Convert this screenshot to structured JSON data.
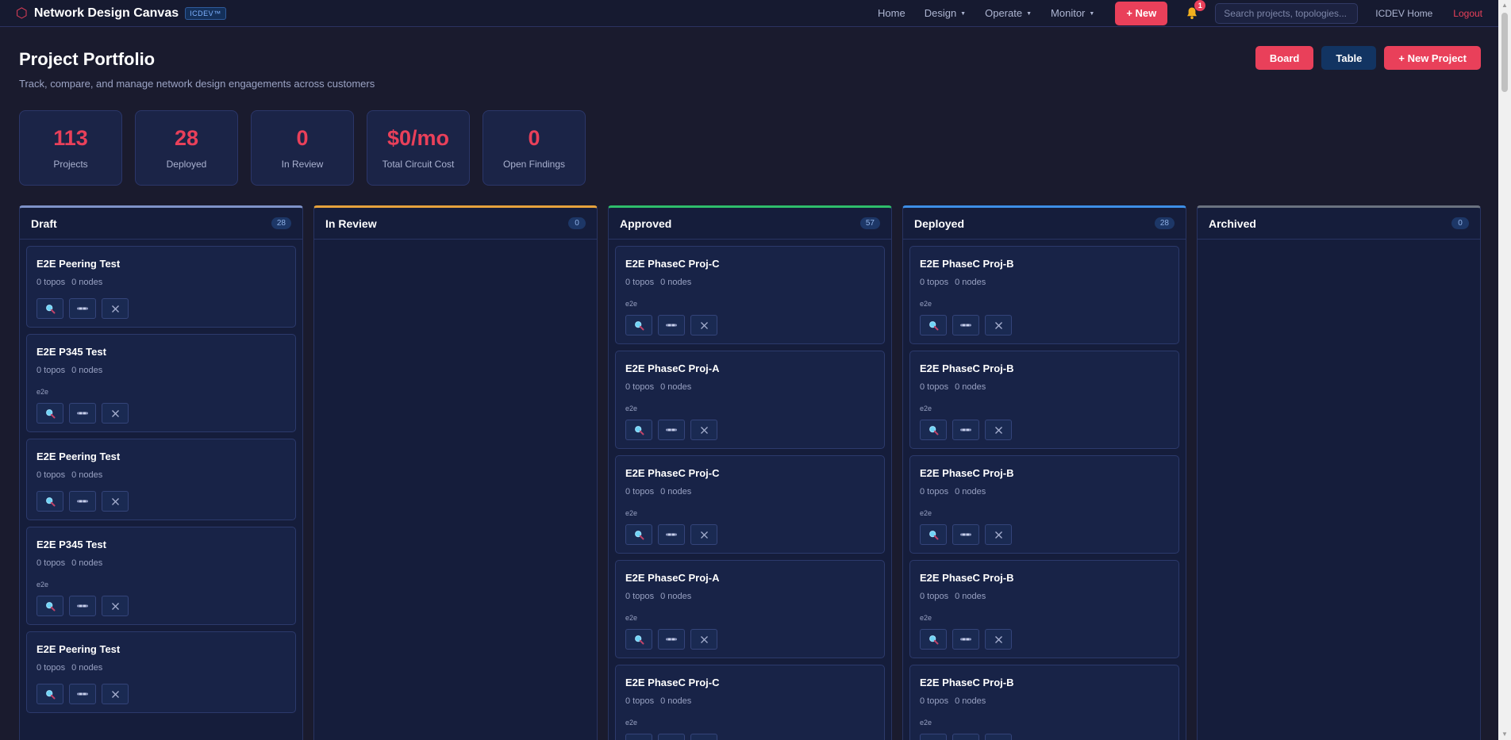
{
  "nav": {
    "brand": "Network Design Canvas",
    "badge": "ICDEV™",
    "links": [
      "Home",
      "Design",
      "Operate",
      "Monitor"
    ],
    "new_label": "+ New",
    "notification_count": "1",
    "search_placeholder": "Search projects, topologies...",
    "icdev_home": "ICDEV Home",
    "logout": "Logout"
  },
  "header": {
    "title": "Project Portfolio",
    "subtitle": "Track, compare, and manage network design engagements across customers",
    "board_label": "Board",
    "table_label": "Table",
    "new_project_label": "+ New Project"
  },
  "stats": [
    {
      "value": "113",
      "label": "Projects"
    },
    {
      "value": "28",
      "label": "Deployed"
    },
    {
      "value": "0",
      "label": "In Review"
    },
    {
      "value": "$0/mo",
      "label": "Total Circuit Cost"
    },
    {
      "value": "0",
      "label": "Open Findings"
    }
  ],
  "columns": [
    {
      "title": "Draft",
      "count": "28",
      "accent": "#7e92c8",
      "cards": [
        {
          "title": "E2E Peering Test",
          "topos": "0 topos",
          "nodes": "0 nodes",
          "tag": ""
        },
        {
          "title": "E2E P345 Test",
          "topos": "0 topos",
          "nodes": "0 nodes",
          "tag": "e2e"
        },
        {
          "title": "E2E Peering Test",
          "topos": "0 topos",
          "nodes": "0 nodes",
          "tag": ""
        },
        {
          "title": "E2E P345 Test",
          "topos": "0 topos",
          "nodes": "0 nodes",
          "tag": "e2e"
        },
        {
          "title": "E2E Peering Test",
          "topos": "0 topos",
          "nodes": "0 nodes",
          "tag": ""
        }
      ]
    },
    {
      "title": "In Review",
      "count": "0",
      "accent": "#e6a23c",
      "cards": []
    },
    {
      "title": "Approved",
      "count": "57",
      "accent": "#2ebd6b",
      "cards": [
        {
          "title": "E2E PhaseC Proj-C",
          "topos": "0 topos",
          "nodes": "0 nodes",
          "tag": "e2e"
        },
        {
          "title": "E2E PhaseC Proj-A",
          "topos": "0 topos",
          "nodes": "0 nodes",
          "tag": "e2e"
        },
        {
          "title": "E2E PhaseC Proj-C",
          "topos": "0 topos",
          "nodes": "0 nodes",
          "tag": "e2e"
        },
        {
          "title": "E2E PhaseC Proj-A",
          "topos": "0 topos",
          "nodes": "0 nodes",
          "tag": "e2e"
        },
        {
          "title": "E2E PhaseC Proj-C",
          "topos": "0 topos",
          "nodes": "0 nodes",
          "tag": "e2e"
        }
      ]
    },
    {
      "title": "Deployed",
      "count": "28",
      "accent": "#3d8ee6",
      "cards": [
        {
          "title": "E2E PhaseC Proj-B",
          "topos": "0 topos",
          "nodes": "0 nodes",
          "tag": "e2e"
        },
        {
          "title": "E2E PhaseC Proj-B",
          "topos": "0 topos",
          "nodes": "0 nodes",
          "tag": "e2e"
        },
        {
          "title": "E2E PhaseC Proj-B",
          "topos": "0 topos",
          "nodes": "0 nodes",
          "tag": "e2e"
        },
        {
          "title": "E2E PhaseC Proj-B",
          "topos": "0 topos",
          "nodes": "0 nodes",
          "tag": "e2e"
        },
        {
          "title": "E2E PhaseC Proj-B",
          "topos": "0 topos",
          "nodes": "0 nodes",
          "tag": "e2e"
        }
      ]
    },
    {
      "title": "Archived",
      "count": "0",
      "accent": "#6b7280",
      "cards": []
    }
  ],
  "card_icons": [
    "magnifier-icon",
    "compare-icon",
    "close-icon"
  ]
}
